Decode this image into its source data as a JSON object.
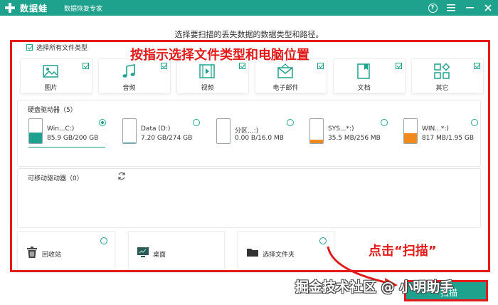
{
  "app": {
    "name": "数据蛙",
    "subtitle": "数据恢复专家"
  },
  "titlebar": {
    "help_label": "?"
  },
  "instruction": "选择要扫描的丢失数据的数据类型和路径。",
  "annotation_main": "按指示选择文件类型和电脑位置",
  "select_all_label": "选择所有文件类型",
  "file_types": [
    {
      "label": "图片",
      "icon": "image-icon",
      "checked": true
    },
    {
      "label": "音频",
      "icon": "music-icon",
      "checked": true
    },
    {
      "label": "视频",
      "icon": "video-icon",
      "checked": true
    },
    {
      "label": "电子邮件",
      "icon": "email-icon",
      "checked": true
    },
    {
      "label": "文档",
      "icon": "document-icon",
      "checked": true
    },
    {
      "label": "其它",
      "icon": "other-icon",
      "checked": true
    }
  ],
  "hard_drives": {
    "title": "硬盘驱动器（5）",
    "items": [
      {
        "name": "Win...C:)",
        "size": "85.9 GB/200 GB",
        "fill_fraction": 0.43,
        "fill_color": "#1fa28d",
        "selected": true
      },
      {
        "name": "Data (D:)",
        "size": "7.20 GB/274 GB",
        "fill_fraction": 0.03,
        "fill_color": "#1fa28d",
        "selected": false
      },
      {
        "name": "分区...:)",
        "size": "0.00  B/16.0 MB",
        "fill_fraction": 0.0,
        "fill_color": "#f08a1c",
        "selected": false
      },
      {
        "name": "SYS...*:)",
        "size": "35.5 MB/256 MB",
        "fill_fraction": 0.14,
        "fill_color": "#f08a1c",
        "selected": false
      },
      {
        "name": "WIN...*:)",
        "size": "817 MB/1.95 GB",
        "fill_fraction": 0.42,
        "fill_color": "#f08a1c",
        "selected": false
      }
    ]
  },
  "removable": {
    "title": "可移动驱动器（0）"
  },
  "locations": [
    {
      "label": "回收站",
      "icon": "trash-icon"
    },
    {
      "label": "桌面",
      "icon": "desktop-icon"
    },
    {
      "label": "选择文件夹",
      "icon": "folder-icon"
    }
  ],
  "click_note": "点击“扫描”",
  "scan_button": "扫描",
  "watermark": "掘金技术社区 @ 小明助手"
}
